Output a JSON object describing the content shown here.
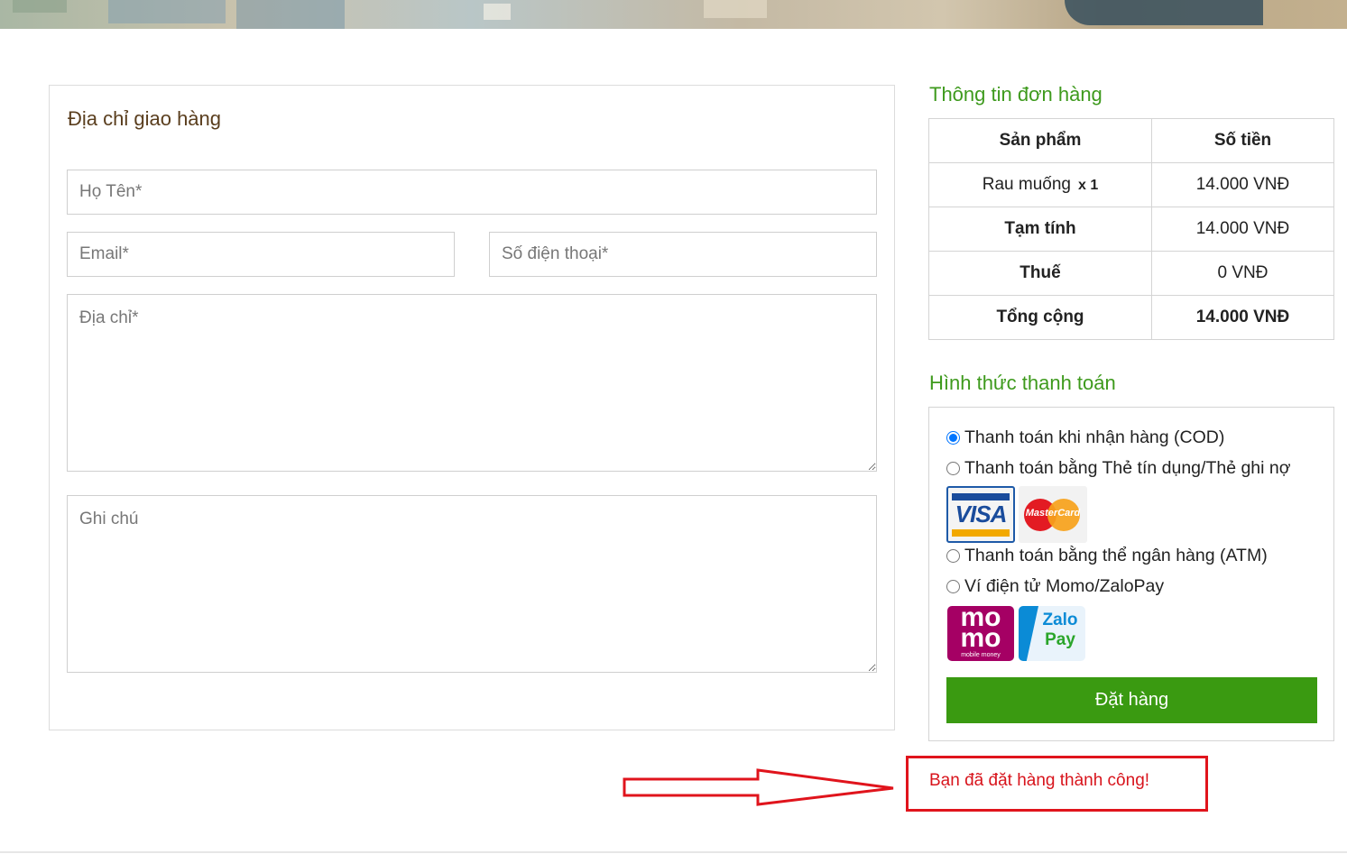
{
  "address": {
    "title": "Địa chỉ giao hàng",
    "name_placeholder": "Họ Tên*",
    "email_placeholder": "Email*",
    "phone_placeholder": "Số điện thoại*",
    "address_placeholder": "Địa chỉ*",
    "note_placeholder": "Ghi chú"
  },
  "order": {
    "title": "Thông tin đơn hàng",
    "headers": [
      "Sản phẩm",
      "Số tiền"
    ],
    "item_name": "Rau muống",
    "item_qty": "x 1",
    "item_price": "14.000 VNĐ",
    "subtotal_label": "Tạm tính",
    "subtotal_value": "14.000 VNĐ",
    "tax_label": "Thuế",
    "tax_value": "0 VNĐ",
    "total_label": "Tổng cộng",
    "total_value": "14.000 VNĐ"
  },
  "payment": {
    "title": "Hình thức thanh toán",
    "options": [
      {
        "label": "Thanh toán khi nhận hàng (COD)",
        "checked": true
      },
      {
        "label": "Thanh toán bằng Thẻ tín dụng/Thẻ ghi nợ",
        "checked": false
      },
      {
        "label": "Thanh toán bằng thể ngân hàng (ATM)",
        "checked": false
      },
      {
        "label": "Ví điện tử Momo/ZaloPay",
        "checked": false
      }
    ],
    "logos": {
      "visa": "VISA",
      "mastercard": "MasterCard",
      "momo_top": "mo",
      "momo_bottom": "mo",
      "momo_tag": "mobile money",
      "zalo_top": "Zalo",
      "zalo_bottom": "Pay"
    },
    "submit_label": "Đặt hàng"
  },
  "notification": {
    "message": "Bạn đã đặt hàng thành công!"
  },
  "colors": {
    "accent_green": "#3a9a11",
    "heading_green": "#3e9a1d",
    "title_brown": "#5a3e1e",
    "alert_red": "#e0141c"
  }
}
